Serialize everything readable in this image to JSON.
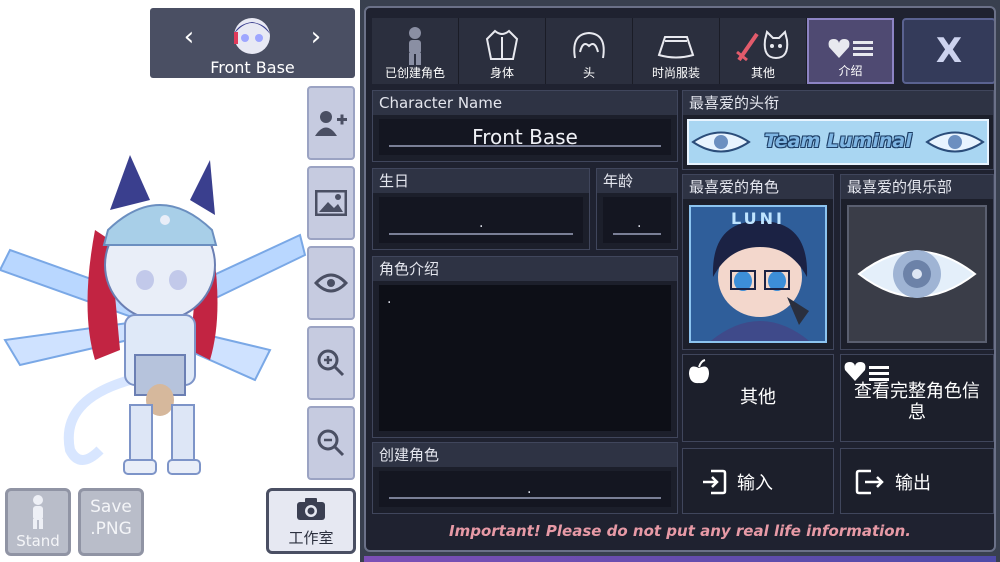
{
  "character_nav": {
    "name": "Front Base",
    "prev_icon": "chevron-left-icon",
    "next_icon": "chevron-right-icon"
  },
  "side_tools": [
    {
      "name": "add-character-icon"
    },
    {
      "name": "background-image-icon"
    },
    {
      "name": "visibility-eye-icon"
    },
    {
      "name": "zoom-in-icon"
    },
    {
      "name": "zoom-out-icon"
    }
  ],
  "bottom": {
    "stand_label": "Stand",
    "save_line1": "Save",
    "save_line2": ".PNG",
    "studio_label": "工作室"
  },
  "tabs": [
    {
      "label": "已创建角色",
      "icon": "character-silhouette-icon"
    },
    {
      "label": "身体",
      "icon": "shirt-icon"
    },
    {
      "label": "头",
      "icon": "hair-icon"
    },
    {
      "label": "时尚服装",
      "icon": "skirt-icon"
    },
    {
      "label": "其他",
      "icon": "sword-and-cat-icon"
    },
    {
      "label": "介绍",
      "icon": "heart-list-icon"
    }
  ],
  "close_label": "X",
  "profile": {
    "name_header": "Character Name",
    "name_value": "Front Base",
    "birthday_header": "生日",
    "birthday_value": ".",
    "age_header": "年龄",
    "age_value": ".",
    "intro_header": "角色介绍",
    "intro_value": ".",
    "creator_header": "创建角色",
    "creator_value": ".",
    "fav_title_header": "最喜爱的头衔",
    "fav_title_value": "Team Luminal",
    "fav_char_header": "最喜爱的角色",
    "fav_club_header": "最喜爱的俱乐部",
    "fav_char_caption": "LUNI",
    "other_label": "其他",
    "full_info_label": "查看完整角色信息",
    "import_label": "输入",
    "export_label": "输出"
  },
  "warning": "Important! Please do not put any real life information.",
  "colors": {
    "panel_bg": "#1f2230",
    "accent_purple": "#8d84c4",
    "warning_pink": "#e79aa6"
  }
}
